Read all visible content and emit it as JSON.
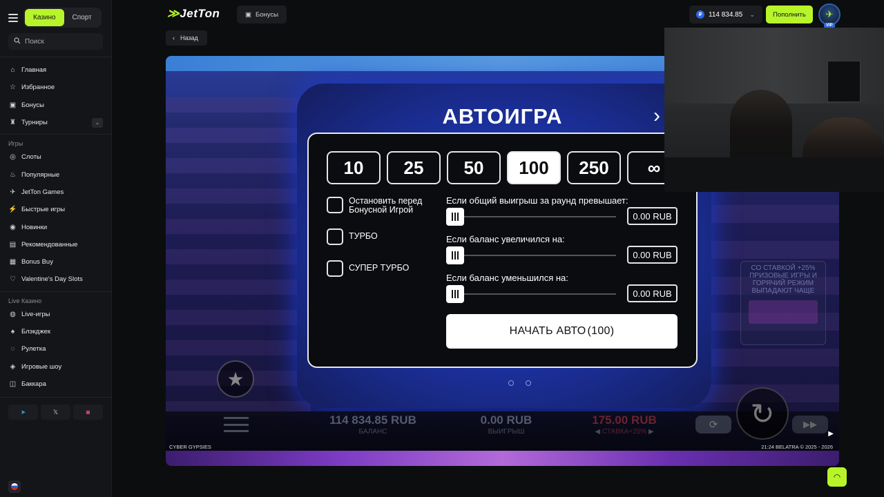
{
  "header": {
    "tabs": [
      "Казино",
      "Спорт"
    ],
    "search_placeholder": "Поиск",
    "logo_text": "JetTon",
    "bonus_label": "Бонусы",
    "balance": "114 834.85",
    "currency_symbol": "₽",
    "deposit_label": "Пополнить",
    "vip_label": "VIP",
    "back_label": "Назад"
  },
  "sidebar": {
    "main_items": [
      {
        "label": "Главная",
        "icon": "home-icon"
      },
      {
        "label": "Избранное",
        "icon": "star-icon"
      },
      {
        "label": "Бонусы",
        "icon": "gift-icon"
      },
      {
        "label": "Турниры",
        "icon": "trophy-icon"
      }
    ],
    "games_heading": "Игры",
    "games_items": [
      {
        "label": "Слоты",
        "icon": "slots-icon"
      },
      {
        "label": "Популярные",
        "icon": "fire-icon"
      },
      {
        "label": "JetTon Games",
        "icon": "jet-icon"
      },
      {
        "label": "Быстрые игры",
        "icon": "lightning-icon"
      },
      {
        "label": "Новинки",
        "icon": "new-icon"
      },
      {
        "label": "Рекомендованные",
        "icon": "thumb-icon"
      },
      {
        "label": "Bonus Buy",
        "icon": "cart-icon"
      },
      {
        "label": "Valentine's Day Slots",
        "icon": "heart-icon"
      }
    ],
    "live_heading": "Live Казино",
    "live_items": [
      {
        "label": "Live-игры",
        "icon": "live-icon"
      },
      {
        "label": "Блэкджек",
        "icon": "cards-icon"
      },
      {
        "label": "Рулетка",
        "icon": "roulette-icon"
      },
      {
        "label": "Игровые шоу",
        "icon": "show-icon"
      },
      {
        "label": "Баккара",
        "icon": "baccarat-icon"
      }
    ],
    "social": [
      "telegram-icon",
      "x-icon",
      "instagram-icon"
    ]
  },
  "game": {
    "dialog_title": "АВТОИГРА",
    "chips": [
      "10",
      "25",
      "50",
      "100",
      "250",
      "∞"
    ],
    "selected_chip": "100",
    "options": [
      {
        "label": "Остановить перед Бонусной Игрой",
        "checked": false
      },
      {
        "label": "ТУРБО",
        "checked": false
      },
      {
        "label": "СУПЕР ТУРБО",
        "checked": false
      }
    ],
    "conditions": [
      {
        "label": "Если общий выигрыш за раунд превышает:",
        "value": "0.00 RUB"
      },
      {
        "label": "Если баланс увеличился на:",
        "value": "0.00 RUB"
      },
      {
        "label": "Если баланс уменьшился на:",
        "value": "0.00 RUB"
      }
    ],
    "start_label": "НАЧАТЬ АВТО",
    "start_count": "(100)",
    "stats": {
      "balance_value": "114 834.85 RUB",
      "balance_label": "БАЛАНС",
      "win_value": "0.00 RUB",
      "win_label": "ВЫИГРЫШ",
      "bet_value": "175.00 RUB",
      "bet_label": "СТАВКА+25%"
    },
    "promo_text": "СО СТАВКОЙ +25% ПРИЗОВЫЕ ИГРЫ И ГОРЯЧИЙ РЕЖИМ ВЫПАДАЮТ ЧАЩЕ",
    "game_name": "CYBER GYPSIES",
    "footer_right": "21:24  BELATRA © 2025 - 2026"
  },
  "colors": {
    "accent": "#b7f52a",
    "bg": "#0c0d0f"
  }
}
